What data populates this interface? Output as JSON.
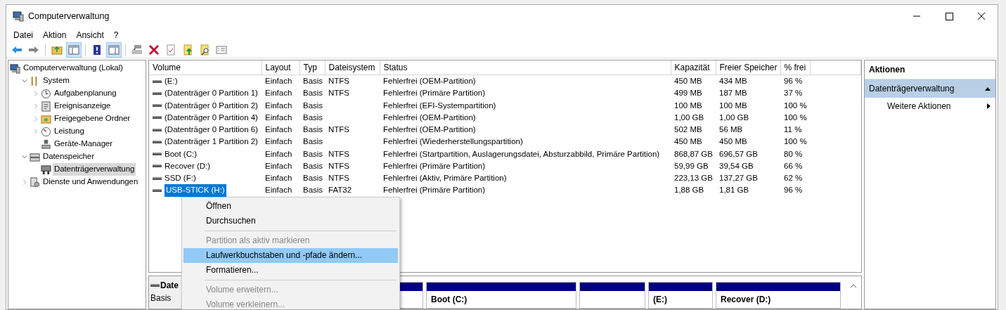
{
  "window": {
    "title": "Computerverwaltung"
  },
  "menu_bar": [
    "Datei",
    "Aktion",
    "Ansicht",
    "?"
  ],
  "toolbar": [
    {
      "kind": "back",
      "pressed": false
    },
    {
      "kind": "forward",
      "pressed": false
    },
    {
      "kind": "sep"
    },
    {
      "kind": "folder-up",
      "pressed": false
    },
    {
      "kind": "tree-pane",
      "pressed": true
    },
    {
      "kind": "sep"
    },
    {
      "kind": "help",
      "pressed": false
    },
    {
      "kind": "action-pane",
      "pressed": true
    },
    {
      "kind": "sep"
    },
    {
      "kind": "connect",
      "pressed": false
    },
    {
      "kind": "delete",
      "pressed": false
    },
    {
      "kind": "check",
      "pressed": false
    },
    {
      "kind": "doc-up",
      "pressed": false
    },
    {
      "kind": "doc-search",
      "pressed": false
    },
    {
      "kind": "props",
      "pressed": false
    }
  ],
  "tree": [
    {
      "label": "Computerverwaltung (Lokal)",
      "selected": false,
      "children": [
        {
          "label": "System",
          "selected": false,
          "expanded": true,
          "children": [
            {
              "label": "Aufgabenplanung",
              "selected": false,
              "expanded": false
            },
            {
              "label": "Ereignisanzeige",
              "selected": false,
              "expanded": false
            },
            {
              "label": "Freigegebene Ordner",
              "selected": false,
              "expanded": false
            },
            {
              "label": "Leistung",
              "selected": false,
              "expanded": false
            },
            {
              "label": "Geräte-Manager",
              "selected": false
            }
          ]
        },
        {
          "label": "Datenspeicher",
          "selected": false,
          "expanded": true,
          "children": [
            {
              "label": "Datenträgerverwaltung",
              "selected": true
            }
          ]
        },
        {
          "label": "Dienste und Anwendungen",
          "selected": false,
          "expanded": false
        }
      ]
    }
  ],
  "table": {
    "columns": [
      "Volume",
      "Layout",
      "Typ",
      "Dateisystem",
      "Status",
      "Kapazität",
      "Freier Speicher",
      "% frei"
    ],
    "rows": [
      {
        "cells": [
          "(E:)",
          "Einfach",
          "Basis",
          "NTFS",
          "Fehlerfrei (OEM-Partition)",
          "450 MB",
          "434 MB",
          "96 %"
        ],
        "selected": false
      },
      {
        "cells": [
          "(Datenträger 0 Partition 1)",
          "Einfach",
          "Basis",
          "NTFS",
          "Fehlerfrei (Primäre Partition)",
          "499 MB",
          "187 MB",
          "37 %"
        ],
        "selected": false
      },
      {
        "cells": [
          "(Datenträger 0 Partition 2)",
          "Einfach",
          "Basis",
          "",
          "Fehlerfrei (EFI-Systempartition)",
          "100 MB",
          "100 MB",
          "100 %"
        ],
        "selected": false
      },
      {
        "cells": [
          "(Datenträger 0 Partition 4)",
          "Einfach",
          "Basis",
          "",
          "Fehlerfrei (OEM-Partition)",
          "1,00 GB",
          "1,00 GB",
          "100 %"
        ],
        "selected": false
      },
      {
        "cells": [
          "(Datenträger 0 Partition 6)",
          "Einfach",
          "Basis",
          "NTFS",
          "Fehlerfrei (OEM-Partition)",
          "502 MB",
          "56 MB",
          "11 %"
        ],
        "selected": false
      },
      {
        "cells": [
          "(Datenträger 1 Partition 2)",
          "Einfach",
          "Basis",
          "",
          "Fehlerfrei (Wiederherstellungspartition)",
          "450 MB",
          "450 MB",
          "100 %"
        ],
        "selected": false
      },
      {
        "cells": [
          "Boot (C:)",
          "Einfach",
          "Basis",
          "NTFS",
          "Fehlerfrei (Startpartition, Auslagerungsdatei, Absturzabbild, Primäre Partition)",
          "868,87 GB",
          "696,57 GB",
          "80 %"
        ],
        "selected": false
      },
      {
        "cells": [
          "Recover (D:)",
          "Einfach",
          "Basis",
          "NTFS",
          "Fehlerfrei (Primäre Partition)",
          "59,99 GB",
          "39,54 GB",
          "66 %"
        ],
        "selected": false
      },
      {
        "cells": [
          "SSD (F:)",
          "Einfach",
          "Basis",
          "NTFS",
          "Fehlerfrei (Aktiv, Primäre Partition)",
          "223,13 GB",
          "137,27 GB",
          "62 %"
        ],
        "selected": false
      },
      {
        "cells": [
          "USB-STICK (H:)",
          "Einfach",
          "Basis",
          "FAT32",
          "Fehlerfrei (Primäre Partition)",
          "1,88 GB",
          "1,81 GB",
          "96 %"
        ],
        "selected": true
      }
    ]
  },
  "disk_view": {
    "disk": {
      "name": "Date",
      "type": "Basis"
    },
    "partitions": [
      {
        "kind": "partition"
      },
      {
        "kind": "partition",
        "label": "Boot  (C:)"
      },
      {
        "kind": "partition"
      },
      {
        "kind": "partition",
        "label": "(E:)"
      },
      {
        "kind": "partition",
        "label": "Recover  (D:)"
      }
    ]
  },
  "actions": {
    "title": "Aktionen",
    "section": {
      "label": "Datenträgerverwaltung",
      "expanded": true
    },
    "items": [
      "Weitere Aktionen"
    ]
  },
  "context_menu": [
    {
      "kind": "item",
      "label": "Öffnen",
      "disabled": false,
      "selected": false
    },
    {
      "kind": "item",
      "label": "Durchsuchen",
      "disabled": false,
      "selected": false
    },
    {
      "kind": "separator"
    },
    {
      "kind": "item",
      "label": "Partition als aktiv markieren",
      "disabled": true,
      "selected": false
    },
    {
      "kind": "item",
      "label": "Laufwerkbuchstaben und -pfade ändern...",
      "disabled": false,
      "selected": true
    },
    {
      "kind": "item",
      "label": "Formatieren...",
      "disabled": false,
      "selected": false
    },
    {
      "kind": "separator"
    },
    {
      "kind": "item",
      "label": "Volume erweitern...",
      "disabled": true,
      "selected": false
    },
    {
      "kind": "item",
      "label": "Volume verkleinern...",
      "disabled": true,
      "selected": false
    }
  ]
}
